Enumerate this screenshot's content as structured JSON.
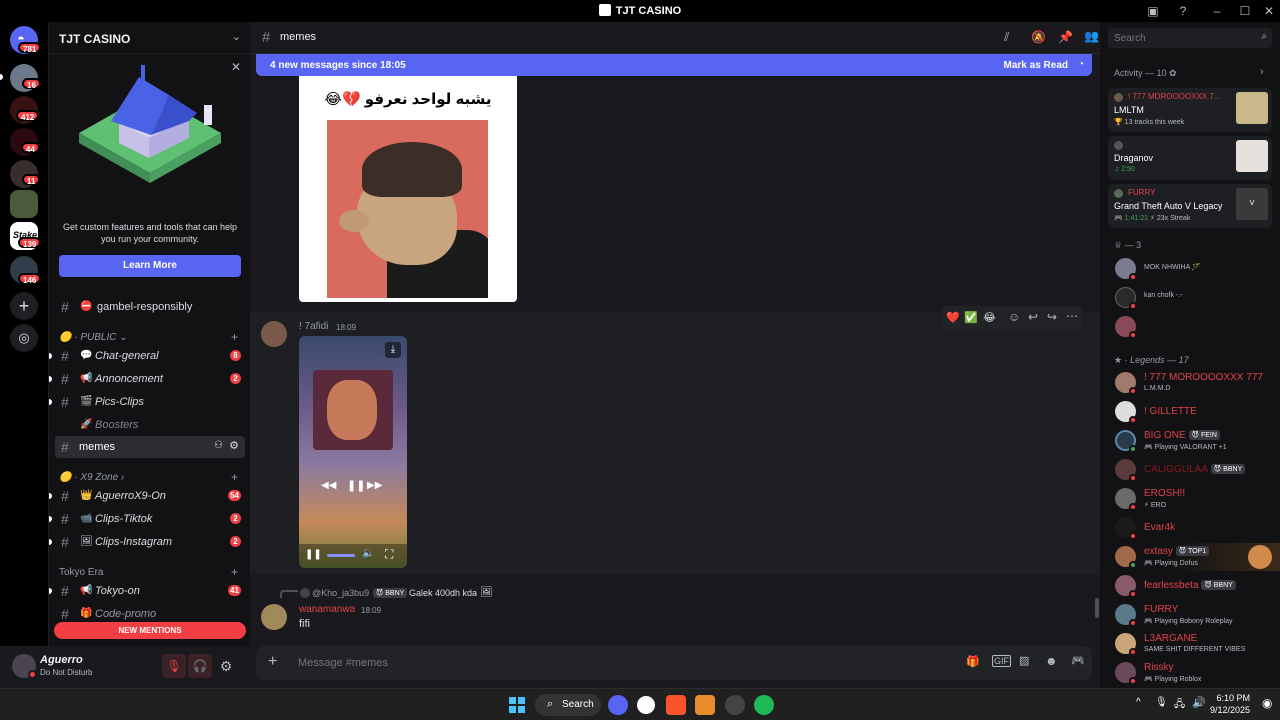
{
  "window": {
    "title": "TJT CASINO"
  },
  "servers": [
    {
      "badge": "781"
    },
    {
      "badge": "16"
    },
    {
      "badge": "412"
    },
    {
      "badge": "44"
    },
    {
      "badge": "11"
    },
    {
      "badge": ""
    },
    {
      "badge": "139"
    },
    {
      "badge": "146"
    }
  ],
  "guild": {
    "name": "TJT CASINO"
  },
  "promo": {
    "text": "Get custom features and tools that can help you run your community.",
    "button": "Learn More"
  },
  "channels_top": [
    {
      "name": "gambel-responsibly"
    }
  ],
  "cat_public": {
    "name": "PUBLIC"
  },
  "public_channels": [
    {
      "name": "Chat-general",
      "count": "8"
    },
    {
      "name": "Annoncement",
      "count": "2"
    },
    {
      "name": "Pics-Clips",
      "count": ""
    },
    {
      "name": "Boosters",
      "count": ""
    },
    {
      "name": "memes",
      "count": ""
    }
  ],
  "cat_x9": {
    "name": "X9 Zone"
  },
  "x9_channels": [
    {
      "name": "AguerroX9-On",
      "count": "54"
    },
    {
      "name": "Clips-Tiktok",
      "count": "2"
    },
    {
      "name": "Clips-Instagram",
      "count": "2"
    }
  ],
  "cat_tokyo": {
    "name": "Tokyo Era"
  },
  "tokyo_channels": [
    {
      "name": "Tokyo-on",
      "count": "41"
    },
    {
      "name": "Code-promo",
      "count": ""
    }
  ],
  "new_mentions": "NEW MENTIONS",
  "user": {
    "name": "Aguerro",
    "status": "Do Not Disturb"
  },
  "channel": {
    "name": "memes"
  },
  "search": {
    "placeholder": "Search"
  },
  "newbar": {
    "text": "4 new messages since 18:05",
    "action": "Mark as Read"
  },
  "meme": {
    "caption": "يشبه لواحد نعرفو 💔😂"
  },
  "msg1": {
    "author": "! 7afidi",
    "time": "18:09"
  },
  "reactions": [
    "❤️",
    "✅",
    "😂"
  ],
  "msg2": {
    "reply_author": "@Kho_ja3bu9",
    "reply_tag": "BBNY",
    "reply_text": "Galek 400dh kda",
    "author": "wanamanwa",
    "time": "18:09",
    "text": "fifi"
  },
  "composer": {
    "placeholder": "Message #memes"
  },
  "activity": {
    "title": "Activity — 10",
    "cards": [
      {
        "user": "! 777 MDROOOOXXX 7...",
        "title": "LMLTM",
        "sub": "13 tracks this week"
      },
      {
        "user": "",
        "title": "Draganov",
        "sub": "2:50"
      },
      {
        "user": "FURRY",
        "title": "Grand Theft Auto V Legacy",
        "sub": "1:41:21",
        "extra": "23x Streak"
      }
    ]
  },
  "members_group1": {
    "title": "— 3"
  },
  "members1": [
    {
      "name": "MOK NHWIHA 🪄",
      "sub": ""
    },
    {
      "name": "kan chofk -.-",
      "sub": ""
    },
    {
      "name": "",
      "sub": ""
    }
  ],
  "members_group2": {
    "title": "Legends — 17"
  },
  "members2": [
    {
      "name": "! 777 MOROOOOXXX 777",
      "sub": "L.M.M.D",
      "tag": ""
    },
    {
      "name": "! GILLETTE",
      "sub": "",
      "tag": ""
    },
    {
      "name": "BIG ONE",
      "sub": "Playing VALORANT +1",
      "tag": "FE!N"
    },
    {
      "name": "CALIGGULAA",
      "sub": "",
      "tag": "BBNY"
    },
    {
      "name": "EROSH!!",
      "sub": "ERO",
      "tag": ""
    },
    {
      "name": "Evar4k",
      "sub": "",
      "tag": ""
    },
    {
      "name": "extasy",
      "sub": "Playing Dofus",
      "tag": "TOP1"
    },
    {
      "name": "fearlessbeta",
      "sub": "",
      "tag": "BBNY"
    },
    {
      "name": "FURRY",
      "sub": "Playing Bobony Roleplay",
      "tag": ""
    },
    {
      "name": "L3ARGANE",
      "sub": "SAME SHIT DIFFERENT VIBES",
      "tag": ""
    },
    {
      "name": "Rissky",
      "sub": "Playing Roblox",
      "tag": ""
    }
  ],
  "taskbar": {
    "search": "Search",
    "time": "6:10 PM",
    "date": "9/12/2025"
  }
}
